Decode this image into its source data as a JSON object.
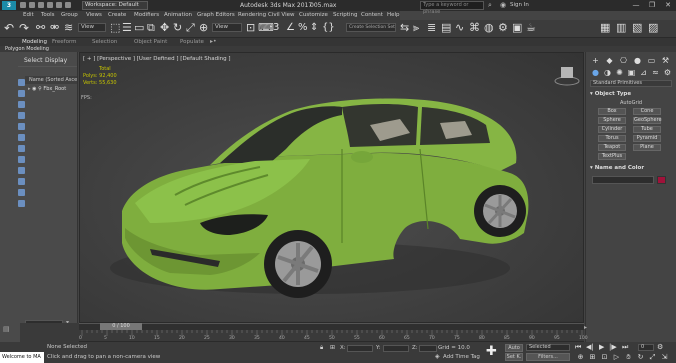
{
  "title_bar": {
    "logo": "3",
    "workspace": "Workspace: Default",
    "app_title": "Autodesk 3ds Max 2017",
    "file_name": "005.max",
    "search_placeholder": "Type a keyword or phrase",
    "sign_in": "Sign In",
    "window_buttons": [
      "—",
      "❐",
      "✕"
    ]
  },
  "menu": [
    "Edit",
    "Tools",
    "Group",
    "Views",
    "Create",
    "Modifiers",
    "Animation",
    "Graph Editors",
    "Rendering",
    "Civil View",
    "Customize",
    "Scripting",
    "Content",
    "Help"
  ],
  "toolbar": {
    "view_dropdown": "View",
    "selection_set": "Create Selection Set"
  },
  "ribbon": {
    "tabs": [
      "Modeling",
      "Freeform",
      "Selection",
      "Object Paint",
      "Populate"
    ],
    "sub_label": "Polygon Modeling"
  },
  "scene_explorer": {
    "tabs": [
      "Select",
      "Display"
    ],
    "header": "Name (Sorted Ascending)",
    "rows": [
      "Fbx_Root"
    ]
  },
  "viewport": {
    "label": "[ + ] [Perspective ] [User Defined ] [Default Shading ]",
    "stats": {
      "total_label": "Total",
      "polys_label": "Polys:",
      "polys_value": "92,400",
      "verts_label": "Verts:",
      "verts_value": "55,630"
    },
    "fps_label": "FPS:"
  },
  "command_panel": {
    "dropdown": "Standard Primitives",
    "object_type_title": "Object Type",
    "autogrid": "AutoGrid",
    "buttons": [
      "Box",
      "Cone",
      "Sphere",
      "GeoSphere",
      "Cylinder",
      "Tube",
      "Torus",
      "Pyramid",
      "Teapot",
      "Plane",
      "TextPlus"
    ],
    "name_color_title": "Name and Color",
    "name_color_hex": "#a0123a"
  },
  "timeline": {
    "thumb": "0 / 100",
    "ticks": [
      "0",
      "5",
      "10",
      "15",
      "20",
      "25",
      "30",
      "35",
      "40",
      "45",
      "50",
      "55",
      "60",
      "65",
      "70",
      "75",
      "80",
      "85",
      "90",
      "95",
      "100"
    ]
  },
  "status": {
    "maxscript": "Welcome to MA",
    "selected": "None Selected",
    "prompt": "Click and drag to pan a non-camera view",
    "x_label": "X:",
    "y_label": "Y:",
    "z_label": "Z:",
    "grid": "Grid = 10.0",
    "add_time_tag": "Add Time Tag",
    "auto": "Auto",
    "set_k": "Set K.",
    "selected_dropdown": "Selected",
    "filters": "Filters...",
    "frame": "0"
  },
  "colors": {
    "car_body": "#7fae3e",
    "viewport_bg": "#444444",
    "accent": "#1b8ba8"
  }
}
